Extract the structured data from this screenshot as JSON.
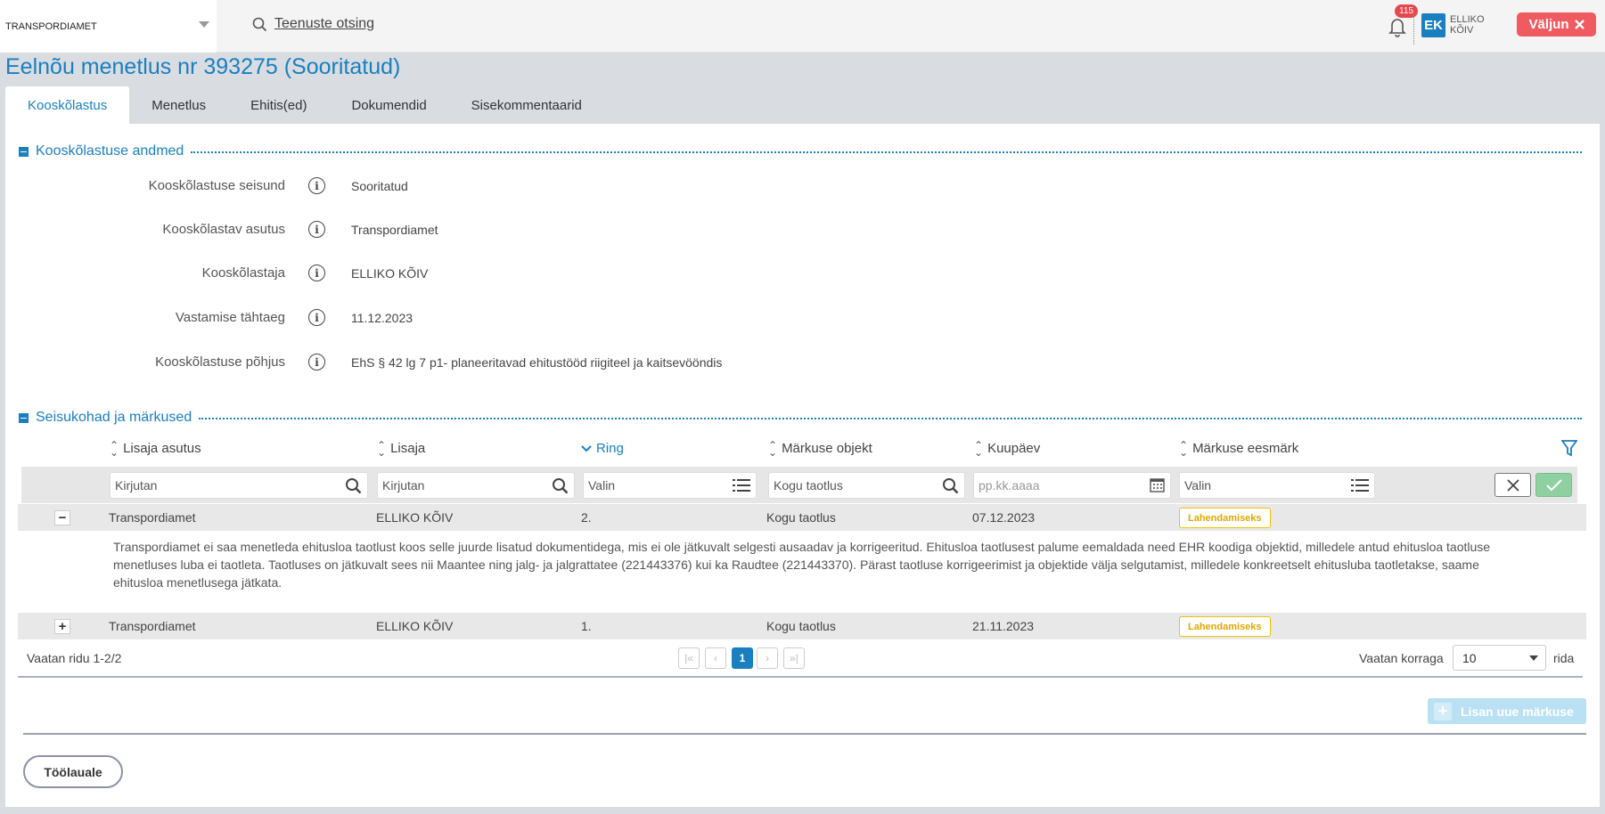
{
  "header": {
    "org": "TRANSPORDIAMET",
    "search_label": "Teenuste otsing",
    "notif_count": "115",
    "user_initials": "EK",
    "user_first": "ELLIKO",
    "user_last": "KÕIV",
    "logout_label": "Väljun"
  },
  "page_title": "Eelnõu menetlus nr 393275 (Sooritatud)",
  "tabs": [
    {
      "label": "Kooskõlastus",
      "active": true
    },
    {
      "label": "Menetlus"
    },
    {
      "label": "Ehitis(ed)"
    },
    {
      "label": "Dokumendid"
    },
    {
      "label": "Sisekommentaarid"
    }
  ],
  "section1": {
    "title": "Kooskõlastuse andmed",
    "fields": [
      {
        "label": "Kooskõlastuse seisund",
        "value": "Sooritatud"
      },
      {
        "label": "Kooskõlastav asutus",
        "value": "Transpordiamet"
      },
      {
        "label": "Kooskõlastaja",
        "value": "ELLIKO KÕIV"
      },
      {
        "label": "Vastamise tähtaeg",
        "value": "11.12.2023"
      },
      {
        "label": "Kooskõlastuse põhjus",
        "value": "EhS § 42 lg 7 p1- planeeritavad ehitustööd riigiteel ja kaitsevööndis"
      }
    ]
  },
  "section2": {
    "title": "Seisukohad ja märkused",
    "columns": [
      "Lisaja asutus",
      "Lisaja",
      "Ring",
      "Märkuse objekt",
      "Kuupäev",
      "Märkuse eesmärk"
    ],
    "filters": {
      "asutus": "Kirjutan",
      "lisaja": "Kirjutan",
      "ring": "Valin",
      "objekt": "Kogu taotlus",
      "kuupaev_placeholder": "pp.kk.aaaa",
      "eesmark": "Valin"
    },
    "rows": [
      {
        "toggle": "−",
        "asutus": "Transpordiamet",
        "lisaja": "ELLIKO KÕIV",
        "ring": "2.",
        "objekt": "Kogu taotlus",
        "kuupaev": "07.12.2023",
        "eesmark": "Lahendamiseks",
        "comment": "Transpordiamet ei saa menetleda ehitusloa taotlust koos selle juurde lisatud dokumentidega, mis ei ole jätkuvalt selgesti ausaadav ja korrigeeritud. Ehitusloa taotlusest palume eemaldada need EHR koodiga objektid, milledele antud ehitusloa taotluse menetluses luba ei taotleta. Taotluses on jätkuvalt sees nii Maantee ning jalg- ja jalgrattatee (221443376) kui ka Raudtee (221443370). Pärast taotluse korrigeerimist ja objektide välja selgutamist, milledele konkreetselt ehitusluba taotletakse, saame ehitusloa menetlusega jätkata."
      },
      {
        "toggle": "+",
        "asutus": "Transpordiamet",
        "lisaja": "ELLIKO KÕIV",
        "ring": "1.",
        "objekt": "Kogu taotlus",
        "kuupaev": "21.11.2023",
        "eesmark": "Lahendamiseks"
      }
    ],
    "pager": {
      "info": "Vaatan ridu 1-2/2",
      "current": "1",
      "per_page_label": "Vaatan korraga",
      "per_page": "10",
      "rida": "rida"
    },
    "add_label": "Lisan uue märkuse"
  },
  "footer": {
    "back_label": "Töölauale"
  },
  "colors": {
    "accent": "#1a7fbf",
    "danger": "#ef5b60",
    "tag": "#f2c200"
  }
}
